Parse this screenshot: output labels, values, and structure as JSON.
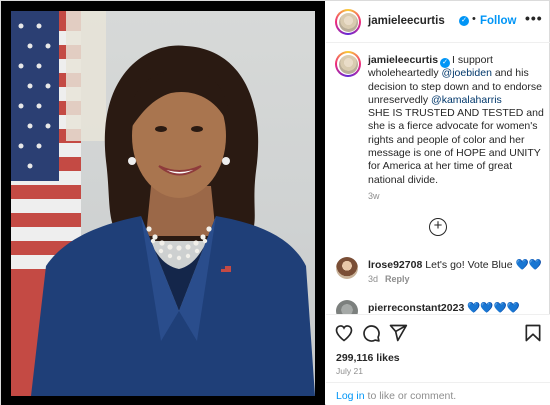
{
  "post": {
    "username": "jamieleecurtis",
    "follow_label": "Follow",
    "separator": "•",
    "more_label": "•••",
    "caption": {
      "part1": "I support wholeheartedly ",
      "mention1": "@joebiden",
      "part2": " and his decision to step down and to endorse unreservedly ",
      "mention2": "@kamalaharris",
      "part3": "SHE IS TRUSTED AND TESTED and she is a fierce advocate for women's rights and people of color and her message is one of HOPE and UNITY for America at her time of great national divide."
    },
    "age": "3w",
    "load_more": "+"
  },
  "comments": [
    {
      "username": "lrose92708",
      "text": "Let's go! Vote Blue 💙💙",
      "age": "3d",
      "reply_label": "Reply"
    },
    {
      "username": "pierreconstant2023",
      "text": "💙💙💙💙"
    }
  ],
  "actions": {
    "likes": "299,116 likes",
    "date": "July 21"
  },
  "login": {
    "link": "Log in",
    "text": " to like or comment."
  },
  "colors": {
    "accent": "#0095f6",
    "suit": "#1f3f78",
    "flag_red": "#b23a3a",
    "background_photo": "#d0d3d3"
  },
  "icons": [
    "heart-icon",
    "comment-icon",
    "share-icon",
    "bookmark-icon",
    "verified-badge-icon",
    "more-icon",
    "plus-circle-icon"
  ]
}
